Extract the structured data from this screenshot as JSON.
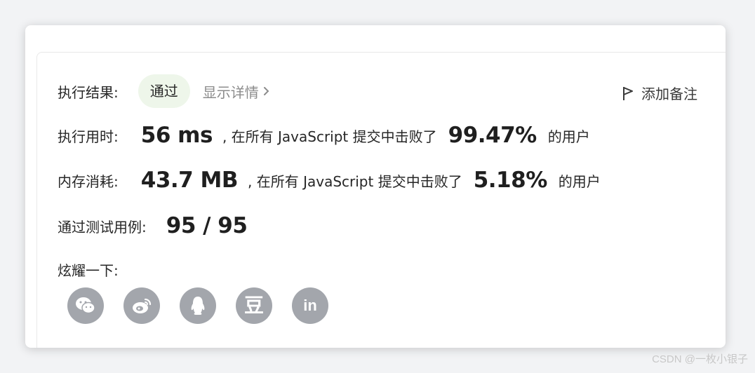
{
  "result": {
    "label": "执行结果:",
    "status_badge": "通过",
    "details_link": "显示详情",
    "add_note": "添加备注"
  },
  "runtime": {
    "label": "执行用时:",
    "value": "56 ms",
    "middle_text": ", 在所有 JavaScript 提交中击败了",
    "percent": "99.47%",
    "suffix": "的用户"
  },
  "memory": {
    "label": "内存消耗:",
    "value": "43.7 MB",
    "middle_text": ", 在所有 JavaScript 提交中击败了",
    "percent": "5.18%",
    "suffix": "的用户"
  },
  "testcases": {
    "label": "通过测试用例:",
    "value": "95 / 95"
  },
  "share": {
    "label": "炫耀一下:",
    "buttons": [
      {
        "icon": "wechat-icon"
      },
      {
        "icon": "weibo-icon"
      },
      {
        "icon": "qq-icon"
      },
      {
        "icon": "douban-icon",
        "glyph": "豆"
      },
      {
        "icon": "linkedin-icon",
        "glyph": "in"
      }
    ]
  },
  "watermark": "CSDN @一枚小银子",
  "colors": {
    "badge_bg": "#eef6ea",
    "icon_bg": "#a3a6ac",
    "muted_text": "#8c8c8c"
  }
}
